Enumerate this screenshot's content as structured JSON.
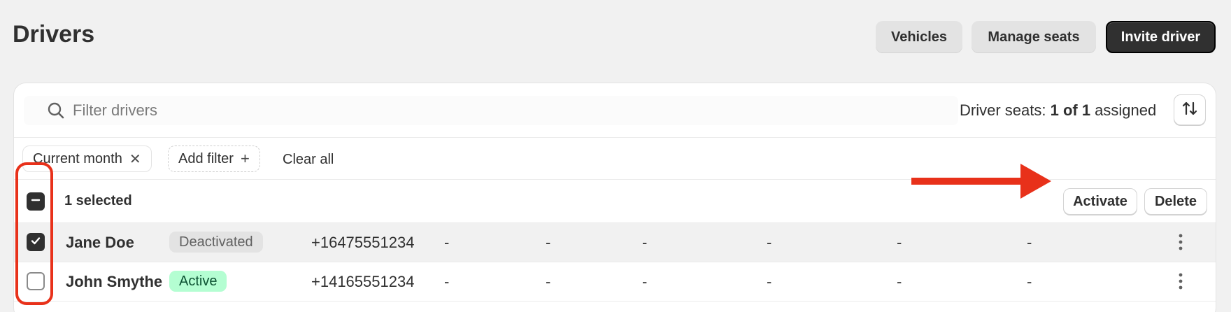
{
  "page": {
    "title": "Drivers"
  },
  "header_actions": {
    "vehicles_label": "Vehicles",
    "manage_seats_label": "Manage seats",
    "invite_driver_label": "Invite driver"
  },
  "search": {
    "placeholder": "Filter drivers",
    "icon": "search-icon"
  },
  "seats": {
    "prefix": "Driver seats: ",
    "count": "1 of 1",
    "suffix": " assigned",
    "sort_icon": "sort-arrows-icon"
  },
  "filters": {
    "chips": [
      {
        "label": "Current month",
        "remove_glyph": "✕"
      }
    ],
    "add_filter_label": "Add filter",
    "add_glyph": "+",
    "clear_all_label": "Clear all"
  },
  "bulk": {
    "selected_text": "1 selected",
    "activate_label": "Activate",
    "delete_label": "Delete"
  },
  "drivers": [
    {
      "name": "Jane Doe",
      "status": "Deactivated",
      "phone": "+16475551234",
      "fields": [
        "-",
        "-",
        "-",
        "-",
        "-",
        "-"
      ],
      "checked": true
    },
    {
      "name": "John Smythe",
      "status": "Active",
      "phone": "+14165551234",
      "fields": [
        "-",
        "-",
        "-",
        "-",
        "-",
        "-"
      ],
      "checked": false
    }
  ],
  "colors": {
    "accent_dark": "#303030",
    "annotation_red": "#e8311a",
    "active_badge": "#b4fed2",
    "deactivated_badge": "#e3e3e3"
  }
}
